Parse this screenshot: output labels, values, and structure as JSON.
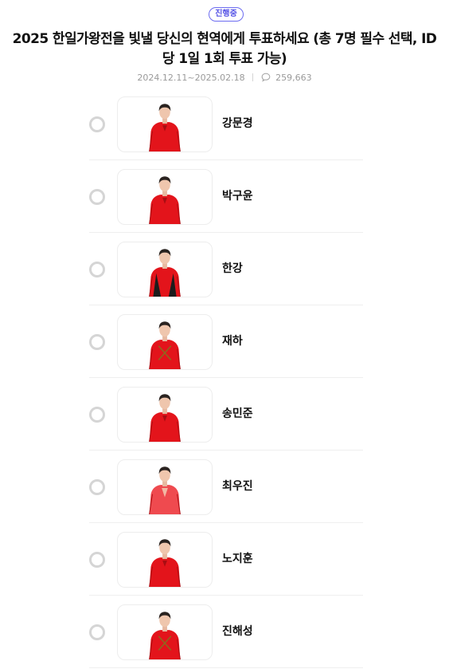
{
  "poll": {
    "status": "진행중",
    "title": "2025 한일가왕전을 빛낼 당신의 현역에게 투표하세요 (총 7명 필수 선택, ID 당 1일 1회 투표 가능)",
    "period": "2024.12.11~2025.02.18",
    "comment_count": "259,663",
    "comment_icon": "comment-bubble-icon"
  },
  "colors": {
    "badge": "#5553e6",
    "outfit_red": "#e3141b",
    "radio_border": "#d5d5d5",
    "meta_text": "#9a9a9a"
  },
  "candidates": [
    {
      "name": "강문경",
      "outfit": "red-glossy-suit"
    },
    {
      "name": "박구윤",
      "outfit": "red-vinyl-jacket"
    },
    {
      "name": "한강",
      "outfit": "red-black-jacket"
    },
    {
      "name": "재하",
      "outfit": "red-embellished-suit"
    },
    {
      "name": "송민준",
      "outfit": "red-sequin-jacket"
    },
    {
      "name": "최우진",
      "outfit": "red-sheer-shirt"
    },
    {
      "name": "노지훈",
      "outfit": "red-suit"
    },
    {
      "name": "진해성",
      "outfit": "red-military-jacket"
    }
  ]
}
